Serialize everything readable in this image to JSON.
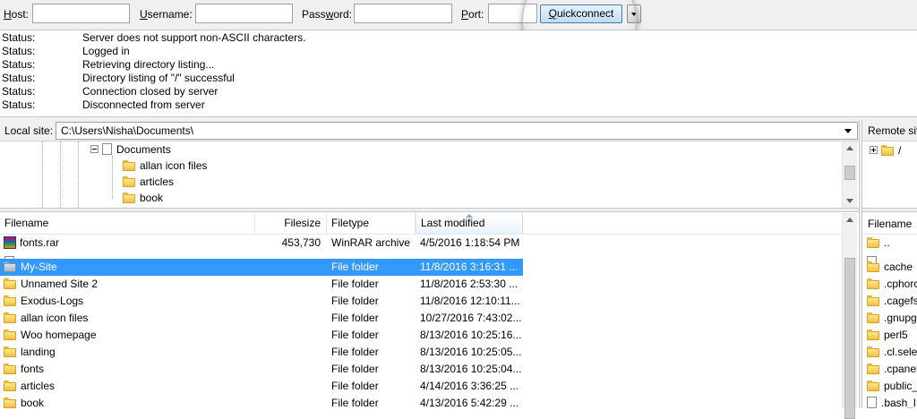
{
  "quickconnect": {
    "host_label_u": "H",
    "host_label_rest": "ost:",
    "username_label_u": "U",
    "username_label_rest": "sername:",
    "password_label_u": "w",
    "password_label_pre": "Pass",
    "password_label_rest": "ord:",
    "port_label_u": "P",
    "port_label_rest": "ort:",
    "host_value": "",
    "username_value": "",
    "password_value": "",
    "port_value": "",
    "button_u": "Q",
    "button_rest": "uickconnect"
  },
  "log": [
    {
      "key": "Status:",
      "value": "Server does not support non-ASCII characters."
    },
    {
      "key": "Status:",
      "value": "Logged in"
    },
    {
      "key": "Status:",
      "value": "Retrieving directory listing..."
    },
    {
      "key": "Status:",
      "value": "Directory listing of \"/\" successful"
    },
    {
      "key": "Status:",
      "value": "Connection closed by server"
    },
    {
      "key": "Status:",
      "value": "Disconnected from server"
    }
  ],
  "local": {
    "site_label": "Local site:",
    "site_path": "C:\\Users\\Nisha\\Documents\\",
    "tree": [
      "Documents",
      "allan icon files",
      "articles",
      "book"
    ],
    "columns": [
      "Filename",
      "Filesize",
      "Filetype",
      "Last modified"
    ],
    "files": [
      {
        "name": "fonts.rar",
        "size": "453,730",
        "type": "WinRAR archive",
        "modified": "4/5/2016 1:18:54 PM",
        "icon": "rar-icon"
      },
      {
        "name": "",
        "size": "",
        "type": "",
        "modified": "",
        "icon": "document-icon"
      },
      {
        "name": "My-Site",
        "size": "",
        "type": "File folder",
        "modified": "11/8/2016 3:16:31 ...",
        "icon": "folder-icon",
        "selected": true
      },
      {
        "name": "Unnamed Site 2",
        "size": "",
        "type": "File folder",
        "modified": "11/8/2016 2:53:30 ...",
        "icon": "folder-icon"
      },
      {
        "name": "Exodus-Logs",
        "size": "",
        "type": "File folder",
        "modified": "11/8/2016 12:10:11...",
        "icon": "folder-icon"
      },
      {
        "name": "allan icon files",
        "size": "",
        "type": "File folder",
        "modified": "10/27/2016 7:43:02...",
        "icon": "folder-icon"
      },
      {
        "name": "Woo homepage",
        "size": "",
        "type": "File folder",
        "modified": "8/13/2016 10:25:16...",
        "icon": "folder-icon"
      },
      {
        "name": "landing",
        "size": "",
        "type": "File folder",
        "modified": "8/13/2016 10:25:05...",
        "icon": "folder-icon"
      },
      {
        "name": "fonts",
        "size": "",
        "type": "File folder",
        "modified": "8/13/2016 10:25:04...",
        "icon": "folder-icon"
      },
      {
        "name": "articles",
        "size": "",
        "type": "File folder",
        "modified": "4/14/2016 3:36:25 ...",
        "icon": "folder-icon"
      },
      {
        "name": "book",
        "size": "",
        "type": "File folder",
        "modified": "4/13/2016 5:42:29 ...",
        "icon": "folder-icon"
      }
    ]
  },
  "remote": {
    "site_label": "Remote sit",
    "tree_root": "/",
    "column": "Filename",
    "files": [
      "..",
      "",
      "cache",
      ".cphorc",
      ".cagefs",
      ".gnupg",
      "perl5",
      ".cl.selec",
      ".cpanel",
      "public_",
      ".bash_l"
    ]
  },
  "colors": {
    "selection": "#3399ff",
    "button_border": "#3c7fb1",
    "folder": "#f2c04a"
  }
}
